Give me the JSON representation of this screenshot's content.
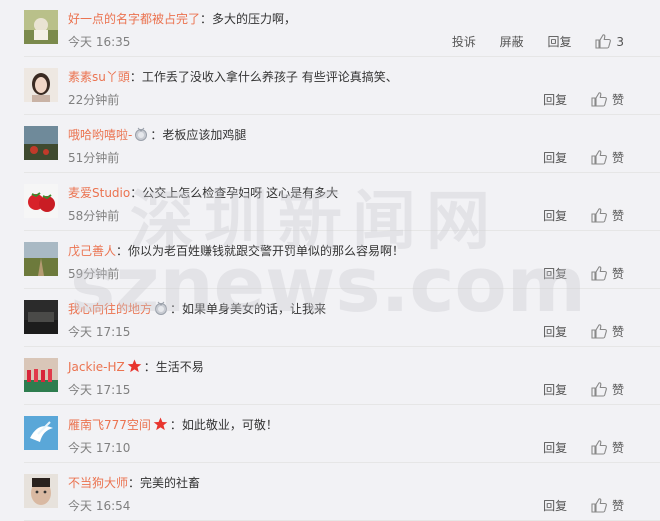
{
  "watermark": {
    "cn": "深圳新闻网",
    "en": "sznews.com"
  },
  "actions": {
    "report": "投诉",
    "block": "屏蔽",
    "reply": "回复",
    "like": "赞"
  },
  "comments": [
    {
      "user": "好一点的名字都被占完了",
      "colon": "：",
      "text": "多大的压力啊，",
      "time": "今天 16:35",
      "like_count": "3",
      "badge": ""
    },
    {
      "user": "素素su丫頭",
      "colon": "：",
      "text": "工作丢了没收入拿什么养孩子 有些评论真搞笑、",
      "time": "22分钟前",
      "badge": ""
    },
    {
      "user": "哦哈哟嘻啦-",
      "colon": "：",
      "text": "老板应该加鸡腿",
      "time": "51分钟前",
      "badge": "medal-icon"
    },
    {
      "user": "麦爱Studio",
      "colon": "：",
      "text": "公交上怎么检查孕妇呀 这心是有多大",
      "time": "58分钟前",
      "badge": ""
    },
    {
      "user": "戊己善人",
      "colon": "：",
      "text": "你以为老百姓赚钱就跟交警开罚单似的那么容易啊！",
      "time": "59分钟前",
      "badge": ""
    },
    {
      "user": "我心向往的地方",
      "colon": "：",
      "text": "如果单身美女的话，让我来",
      "time": "今天 17:15",
      "badge": "medal-icon"
    },
    {
      "user": "Jackie-HZ",
      "colon": "：",
      "text": "生活不易",
      "time": "今天 17:15",
      "badge": "star-icon"
    },
    {
      "user": "雁南飞777空间",
      "colon": "：",
      "text": "如此敬业，可敬！",
      "time": "今天 17:10",
      "badge": "star-icon"
    },
    {
      "user": "不当狗大师",
      "colon": "：",
      "text": "完美的社畜",
      "time": "今天 16:54",
      "badge": ""
    }
  ]
}
